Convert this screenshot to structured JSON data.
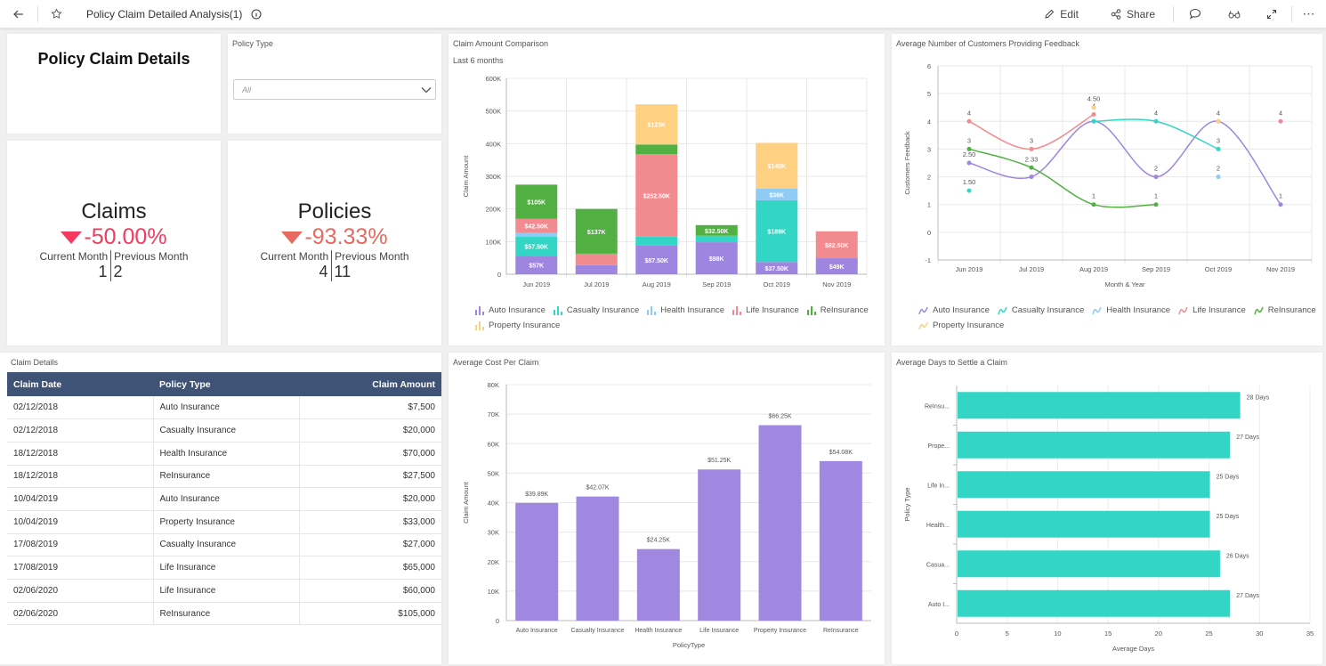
{
  "topbar": {
    "title": "Policy Claim Detailed Analysis(1)",
    "edit_label": "Edit",
    "share_label": "Share"
  },
  "header_panel": {
    "title": "Policy Claim Details"
  },
  "filter": {
    "label": "Policy Type",
    "selected": "All"
  },
  "kpis": {
    "claims": {
      "name": "Claims",
      "change": "-50.00%",
      "current_label": "Current Month",
      "previous_label": "Previous Month",
      "current": "1",
      "previous": "2",
      "color": "#f43a5f"
    },
    "policies": {
      "name": "Policies",
      "change": "-93.33%",
      "current_label": "Current Month",
      "previous_label": "Previous Month",
      "current": "4",
      "previous": "11",
      "color": "#e66a5f"
    }
  },
  "claim_details": {
    "title": "Claim Details",
    "columns": [
      "Claim Date",
      "Policy Type",
      "Claim Amount"
    ],
    "rows": [
      [
        "02/12/2018",
        "Auto Insurance",
        "$7,500"
      ],
      [
        "02/12/2018",
        "Casualty Insurance",
        "$20,000"
      ],
      [
        "18/12/2018",
        "Health Insurance",
        "$70,000"
      ],
      [
        "18/12/2018",
        "ReInsurance",
        "$27,500"
      ],
      [
        "10/04/2019",
        "Auto Insurance",
        "$20,000"
      ],
      [
        "10/04/2019",
        "Property Insurance",
        "$33,000"
      ],
      [
        "17/08/2019",
        "Casualty Insurance",
        "$27,000"
      ],
      [
        "17/08/2019",
        "Life Insurance",
        "$65,000"
      ],
      [
        "02/06/2020",
        "Life Insurance",
        "$60,000"
      ],
      [
        "02/06/2020",
        "ReInsurance",
        "$105,000"
      ]
    ]
  },
  "colors": {
    "Auto Insurance": "#9e86e0",
    "Casualty Insurance": "#33d6c4",
    "Health Insurance": "#8ecbf5",
    "Life Insurance": "#f28b8f",
    "ReInsurance": "#52b043",
    "Property Insurance": "#fdd082"
  },
  "chart_data": [
    {
      "id": "claim_amount_comparison",
      "type": "bar",
      "stacked": true,
      "title": "Claim Amount Comparison",
      "subtitle": "Last 6 months",
      "xlabel": "",
      "ylabel": "Claim Amount",
      "ylim": [
        0,
        600000
      ],
      "yticks": [
        "0",
        "100K",
        "200K",
        "300K",
        "400K",
        "500K",
        "600K"
      ],
      "categories": [
        "Jun 2019",
        "Jul 2019",
        "Aug 2019",
        "Sep 2019",
        "Oct 2019",
        "Nov 2019"
      ],
      "legend": "bottom",
      "series": [
        {
          "name": "Auto Insurance",
          "values": [
            57000,
            28000,
            87500,
            98000,
            37500,
            49000
          ],
          "labels": [
            "$57K",
            "",
            "$87.50K",
            "$98K",
            "$37.50K",
            "$49K"
          ]
        },
        {
          "name": "Casualty Insurance",
          "values": [
            57500,
            0,
            27500,
            20000,
            189000,
            0
          ],
          "labels": [
            "$57.50K",
            "",
            "",
            "",
            "$189K",
            ""
          ]
        },
        {
          "name": "Health Insurance",
          "values": [
            12500,
            0,
            0,
            0,
            36000,
            0
          ],
          "labels": [
            "",
            "",
            "",
            "",
            "$36K",
            ""
          ]
        },
        {
          "name": "Life Insurance",
          "values": [
            42500,
            35000,
            252500,
            0,
            0,
            82500
          ],
          "labels": [
            "$42.50K",
            "",
            "$252.50K",
            "",
            "",
            "$82.50K"
          ]
        },
        {
          "name": "ReInsurance",
          "values": [
            105000,
            137000,
            30000,
            32500,
            0,
            0
          ],
          "labels": [
            "$105K",
            "$137K",
            "",
            "$32.50K",
            "",
            ""
          ]
        },
        {
          "name": "Property Insurance",
          "values": [
            0,
            0,
            123000,
            0,
            140000,
            0
          ],
          "labels": [
            "",
            "",
            "$123K",
            "",
            "$140K",
            ""
          ]
        }
      ]
    },
    {
      "id": "avg_customers_feedback",
      "type": "line",
      "title": "Average Number of Customers Providing Feedback",
      "xlabel": "Month & Year",
      "ylabel": "Customers Feedback",
      "ylim": [
        -1,
        6
      ],
      "yticks": [
        "-1",
        "0",
        "1",
        "2",
        "3",
        "4",
        "5",
        "6"
      ],
      "categories": [
        "Jun 2019",
        "Jul 2019",
        "Aug 2019",
        "Sep 2019",
        "Oct 2019",
        "Nov 2019"
      ],
      "legend": "bottom",
      "series": [
        {
          "name": "Auto Insurance",
          "values": [
            2.5,
            2,
            4,
            2,
            4,
            1
          ],
          "labels": [
            "2.50",
            "",
            "",
            "2",
            "",
            "1"
          ]
        },
        {
          "name": "Casualty Insurance",
          "values": [
            1.5,
            null,
            4,
            4,
            3,
            null
          ],
          "labels": [
            "1.50",
            "",
            "",
            "4",
            "3",
            ""
          ]
        },
        {
          "name": "Health Insurance",
          "values": [
            null,
            null,
            null,
            null,
            2,
            null
          ],
          "labels": [
            "",
            "",
            "",
            "",
            "2",
            ""
          ]
        },
        {
          "name": "Life Insurance",
          "values": [
            4,
            3,
            4.25,
            null,
            null,
            4
          ],
          "labels": [
            "4",
            "3",
            "4",
            "",
            "",
            "4"
          ]
        },
        {
          "name": "ReInsurance",
          "values": [
            3,
            2.33,
            1,
            1,
            null,
            null
          ],
          "labels": [
            "3",
            "2.33",
            "1",
            "1",
            "",
            ""
          ]
        },
        {
          "name": "Property Insurance",
          "values": [
            null,
            null,
            4.5,
            null,
            4,
            null
          ],
          "labels": [
            "",
            "",
            "4.50",
            "",
            "4",
            ""
          ]
        }
      ]
    },
    {
      "id": "avg_cost_per_claim",
      "type": "bar",
      "title": "Average Cost Per Claim",
      "xlabel": "PolicyType",
      "ylabel": "Claim Amount",
      "ylim": [
        0,
        80000
      ],
      "yticks": [
        "0",
        "10K",
        "20K",
        "30K",
        "40K",
        "50K",
        "60K",
        "70K",
        "80K"
      ],
      "categories": [
        "Auto Insurance",
        "Casualty Insurance",
        "Health Insurance",
        "Life Insurance",
        "Property Insurance",
        "ReInsurance"
      ],
      "values": [
        39890,
        42070,
        24250,
        51250,
        66250,
        54080
      ],
      "labels": [
        "$39.89K",
        "$42.07K",
        "$24.25K",
        "$51.25K",
        "$66.25K",
        "$54.08K"
      ],
      "color": "#a088e0"
    },
    {
      "id": "avg_days_to_settle",
      "type": "bar",
      "orientation": "horizontal",
      "title": "Average Days to Settle a Claim",
      "xlabel": "Average Days",
      "ylabel": "Policy Type",
      "xlim": [
        0,
        35
      ],
      "xticks": [
        "0",
        "5",
        "10",
        "15",
        "20",
        "25",
        "30",
        "35"
      ],
      "categories": [
        "ReInsu...",
        "Prope...",
        "Life In...",
        "Health...",
        "Casua...",
        "Auto I..."
      ],
      "values": [
        28,
        27,
        25,
        25,
        26,
        27
      ],
      "labels": [
        "28 Days",
        "27 Days",
        "25 Days",
        "25 Days",
        "26 Days",
        "27 Days"
      ],
      "color": "#33d6c4"
    }
  ]
}
